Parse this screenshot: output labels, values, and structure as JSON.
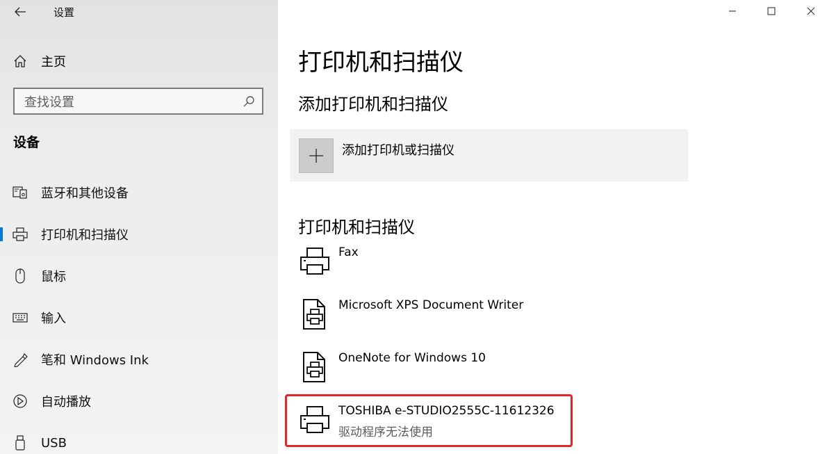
{
  "window": {
    "title": "设置",
    "controls": [
      "minimize",
      "maximize",
      "close"
    ]
  },
  "sidebar": {
    "home_label": "主页",
    "search_placeholder": "查找设置",
    "section_title": "设备",
    "items": [
      {
        "label": "蓝牙和其他设备",
        "icon": "bluetooth-devices-icon"
      },
      {
        "label": "打印机和扫描仪",
        "icon": "printer-icon",
        "active": true
      },
      {
        "label": "鼠标",
        "icon": "mouse-icon"
      },
      {
        "label": "输入",
        "icon": "keyboard-icon"
      },
      {
        "label": "笔和 Windows Ink",
        "icon": "pen-icon"
      },
      {
        "label": "自动播放",
        "icon": "autoplay-icon"
      },
      {
        "label": "USB",
        "icon": "usb-icon"
      }
    ]
  },
  "main": {
    "title": "打印机和扫描仪",
    "add_section_title": "添加打印机和扫描仪",
    "add_button_label": "添加打印机或扫描仪",
    "list_section_title": "打印机和扫描仪",
    "printers": [
      {
        "name": "Fax",
        "status": "",
        "icon": "printer-icon"
      },
      {
        "name": "Microsoft XPS Document Writer",
        "status": "",
        "icon": "document-printer-icon"
      },
      {
        "name": "OneNote for Windows 10",
        "status": "",
        "icon": "document-printer-icon"
      },
      {
        "name": "TOSHIBA e-STUDIO2555C-11612326",
        "status": "驱动程序无法使用",
        "icon": "printer-icon",
        "highlighted": true
      }
    ]
  },
  "colors": {
    "accent": "#0078d7",
    "highlight_border": "#e8232a",
    "sidebar_bg": "#ececec",
    "tile_bg": "#f2f2f2"
  }
}
